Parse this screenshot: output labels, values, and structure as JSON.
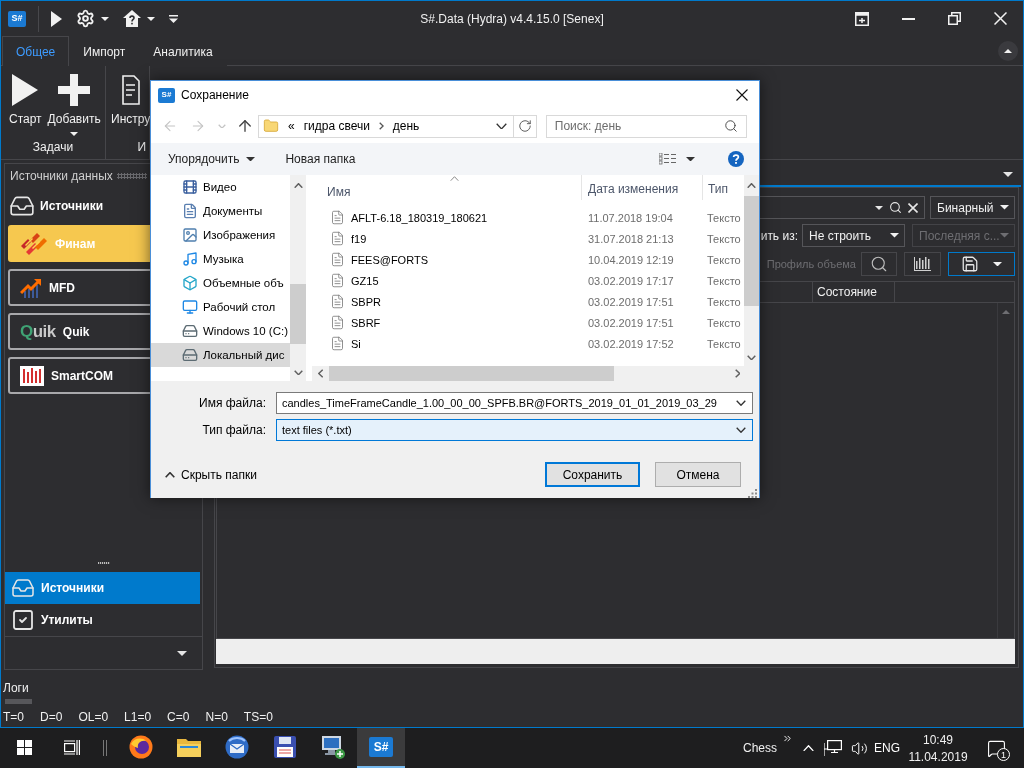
{
  "window": {
    "logo": "S#",
    "title": "S#.Data (Hydra) v4.4.15.0 [Senex]"
  },
  "ribbon": {
    "tabs": [
      {
        "label": "Общее",
        "selected": true
      },
      {
        "label": "Импорт",
        "selected": false
      },
      {
        "label": "Аналитика",
        "selected": false
      }
    ],
    "groups": [
      {
        "label": "Задачи",
        "buttons": [
          {
            "label": "Старт",
            "kind": "play",
            "dropdown": false
          },
          {
            "label": "Добавить",
            "kind": "add",
            "dropdown": true
          }
        ]
      },
      {
        "label": "И",
        "buttons": [
          {
            "label": "Инстру",
            "kind": "document",
            "dropdown": false
          }
        ]
      }
    ]
  },
  "sources_panel": {
    "title": "Источники данных",
    "header": "Источники",
    "sources": [
      {
        "label": "Финам",
        "kind": "finam",
        "selected": true
      },
      {
        "label": "MFD",
        "kind": "mfd",
        "selected": false
      },
      {
        "label": "Quik",
        "kind": "quik",
        "logo": "Quik",
        "selected": false
      },
      {
        "label": "SmartCOM",
        "kind": "smartcom",
        "selected": false
      }
    ]
  },
  "navigation": [
    {
      "label": "Источники",
      "kind": "sources",
      "selected": true
    },
    {
      "label": "Утилиты",
      "kind": "utilities",
      "selected": false
    }
  ],
  "data_panel": {
    "format": "Бинарный",
    "build_from": {
      "label": "ить из:",
      "value": "Не строить"
    },
    "candle_mode": {
      "value": "Последняя с...",
      "disabled": true
    },
    "volume_profile": {
      "label": "Профиль объема",
      "disabled": true
    },
    "columns": [
      "Состояние"
    ]
  },
  "logs": {
    "title": "Логи",
    "counters": [
      "T=0",
      "D=0",
      "OL=0",
      "L1=0",
      "C=0",
      "N=0",
      "TS=0"
    ]
  },
  "dialog": {
    "icon": "S#",
    "title": "Сохранение",
    "path_overflow": "«",
    "path": [
      "гидра свечи",
      "день"
    ],
    "search": {
      "placeholder": "Поиск: день"
    },
    "organize": "Упорядочить",
    "new_folder": "Новая папка",
    "folders": [
      {
        "label": "Видео",
        "kind": "video",
        "selected": false
      },
      {
        "label": "Документы",
        "kind": "documents",
        "selected": false
      },
      {
        "label": "Изображения",
        "kind": "pictures",
        "selected": false
      },
      {
        "label": "Музыка",
        "kind": "music",
        "selected": false
      },
      {
        "label": "Объемные объ",
        "kind": "objects3d",
        "selected": false
      },
      {
        "label": "Рабочий стол",
        "kind": "desktop",
        "selected": false
      },
      {
        "label": "Windows 10 (C:)",
        "kind": "system_drive",
        "selected": false
      },
      {
        "label": "Локальный дис",
        "kind": "drive",
        "selected": true
      }
    ],
    "columns": [
      "Имя",
      "Дата изменения",
      "Тип"
    ],
    "files": [
      {
        "name": "AFLT-6.18_180319_180621",
        "modified": "11.07.2018 19:04",
        "type": "Тексто"
      },
      {
        "name": "f19",
        "modified": "31.07.2018 21:13",
        "type": "Тексто"
      },
      {
        "name": "FEES@FORTS",
        "modified": "10.04.2019 12:19",
        "type": "Тексто"
      },
      {
        "name": "GZ15",
        "modified": "03.02.2019 17:17",
        "type": "Тексто"
      },
      {
        "name": "SBPR",
        "modified": "03.02.2019 17:51",
        "type": "Тексто"
      },
      {
        "name": "SBRF",
        "modified": "03.02.2019 17:51",
        "type": "Тексто"
      },
      {
        "name": "Si",
        "modified": "03.02.2019 17:52",
        "type": "Тексто"
      }
    ],
    "file_name": {
      "label": "Имя файла:",
      "value": "candles_TimeFrameCandle_1.00_00_00_SPFB.BR@FORTS_2019_01_01_2019_03_29",
      "focused": false
    },
    "file_type": {
      "label": "Тип файла:",
      "value": "text files (*.txt)",
      "focused": true
    },
    "hide_folders": "Скрыть папки",
    "buttons": [
      {
        "label": "Сохранить",
        "default": true
      },
      {
        "label": "Отмена",
        "default": false
      }
    ]
  },
  "taskbar": {
    "apps": [
      {
        "kind": "firefox",
        "selected": false
      },
      {
        "kind": "explorer",
        "selected": false
      },
      {
        "kind": "thunderbird",
        "selected": false
      },
      {
        "kind": "floppy",
        "selected": false
      },
      {
        "kind": "remote",
        "selected": false
      },
      {
        "kind": "sharp",
        "label": "S#",
        "selected": true
      }
    ],
    "toolbar": "Chess",
    "language": "ENG",
    "time": "10:49",
    "date": "11.04.2019",
    "notifications": "1"
  }
}
